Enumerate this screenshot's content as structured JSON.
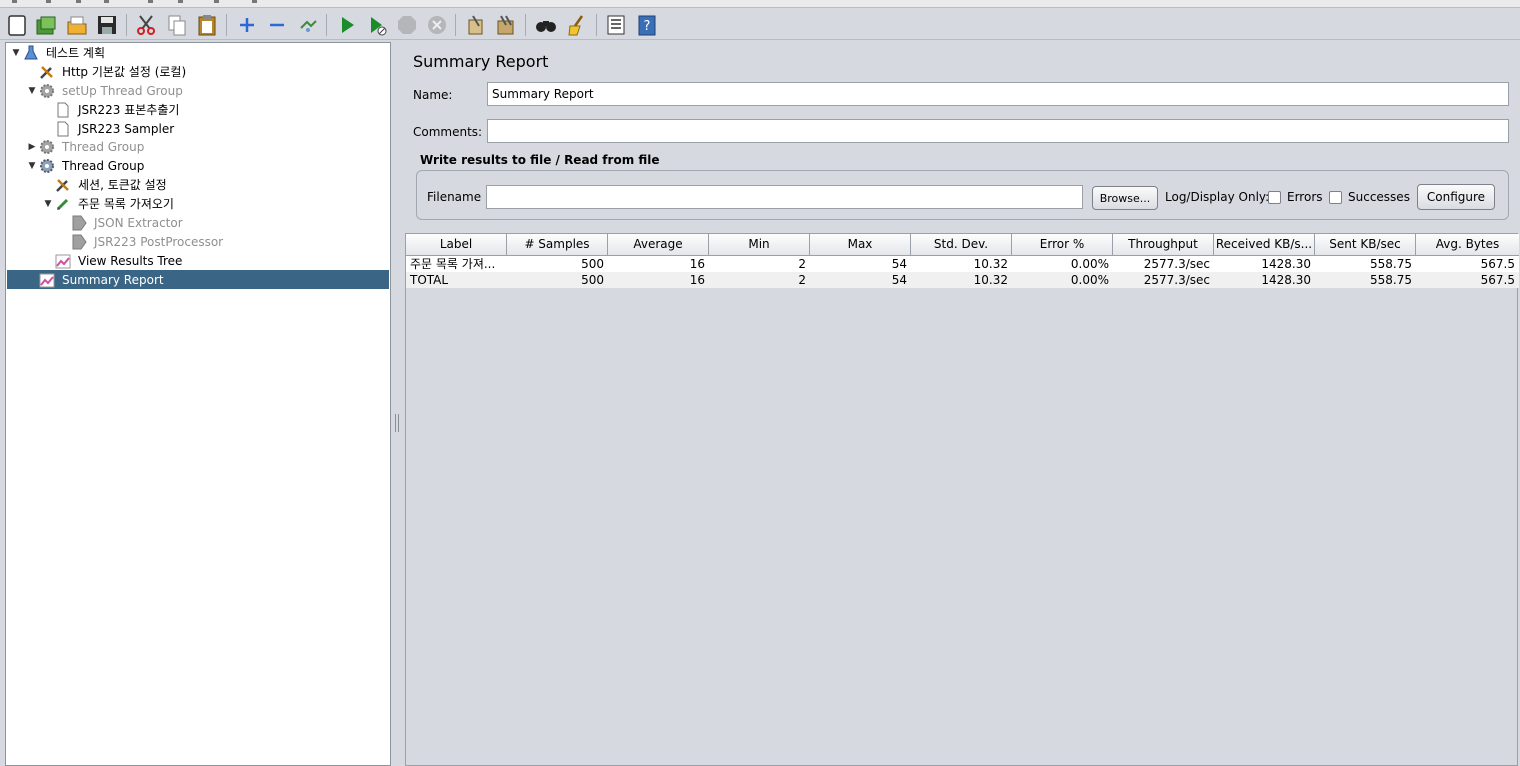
{
  "toolbar": {
    "buttons": [
      {
        "name": "new-icon"
      },
      {
        "name": "templates-icon"
      },
      {
        "name": "open-icon"
      },
      {
        "name": "save-icon"
      },
      {
        "name": "cut-icon"
      },
      {
        "name": "copy-icon"
      },
      {
        "name": "paste-icon"
      },
      {
        "name": "expand-icon"
      },
      {
        "name": "collapse-icon"
      },
      {
        "name": "toggle-icon"
      },
      {
        "name": "start-icon"
      },
      {
        "name": "start-no-pauses-icon"
      },
      {
        "name": "stop-icon"
      },
      {
        "name": "shutdown-icon"
      },
      {
        "name": "clear-icon"
      },
      {
        "name": "clear-all-icon"
      },
      {
        "name": "search-icon"
      },
      {
        "name": "reset-search-icon"
      },
      {
        "name": "function-helper-icon"
      },
      {
        "name": "help-icon"
      }
    ]
  },
  "tree": {
    "items": [
      {
        "label": "테스트 계획",
        "icon": "test-plan-icon",
        "toggle": "▼"
      },
      {
        "label": "Http 기본값 설정 (로컬)",
        "icon": "config-icon"
      },
      {
        "label": "setUp Thread Group",
        "icon": "thread-group-icon",
        "toggle": "▼"
      },
      {
        "label": "JSR223 표본추출기",
        "icon": "sampler-icon"
      },
      {
        "label": "JSR223 Sampler",
        "icon": "sampler-icon"
      },
      {
        "label": "Thread Group",
        "icon": "thread-group-icon",
        "toggle": "▶"
      },
      {
        "label": "Thread Group",
        "icon": "thread-group-icon",
        "toggle": "▼"
      },
      {
        "label": "세션, 토큰값 설정",
        "icon": "config-icon"
      },
      {
        "label": "주문 목록 가져오기",
        "icon": "http-sampler-icon",
        "toggle": "▼"
      },
      {
        "label": "JSON Extractor",
        "icon": "post-processor-icon"
      },
      {
        "label": "JSR223 PostProcessor",
        "icon": "post-processor-icon"
      },
      {
        "label": "View Results Tree",
        "icon": "listener-icon"
      },
      {
        "label": "Summary Report",
        "icon": "listener-icon"
      }
    ]
  },
  "panel": {
    "title": "Summary Report",
    "name_label": "Name:",
    "name_value": "Summary Report",
    "comments_label": "Comments:",
    "comments_value": "",
    "file_group_title": "Write results to file / Read from file",
    "filename_label": "Filename",
    "filename_value": "",
    "browse_label": "Browse...",
    "log_display_label": "Log/Display Only:",
    "errors_label": "Errors",
    "successes_label": "Successes",
    "configure_label": "Configure"
  },
  "table": {
    "columns": [
      "Label",
      "# Samples",
      "Average",
      "Min",
      "Max",
      "Std. Dev.",
      "Error %",
      "Throughput",
      "Received KB/s...",
      "Sent KB/sec",
      "Avg. Bytes"
    ],
    "rows": [
      [
        "주문 목록 가져...",
        "500",
        "16",
        "2",
        "54",
        "10.32",
        "0.00%",
        "2577.3/sec",
        "1428.30",
        "558.75",
        "567.5"
      ],
      [
        "TOTAL",
        "500",
        "16",
        "2",
        "54",
        "10.32",
        "0.00%",
        "2577.3/sec",
        "1428.30",
        "558.75",
        "567.5"
      ]
    ]
  },
  "colors": {
    "selection": "#3a6585",
    "start_green": "#1a8c2a",
    "window_bg": "#d6d9df"
  }
}
